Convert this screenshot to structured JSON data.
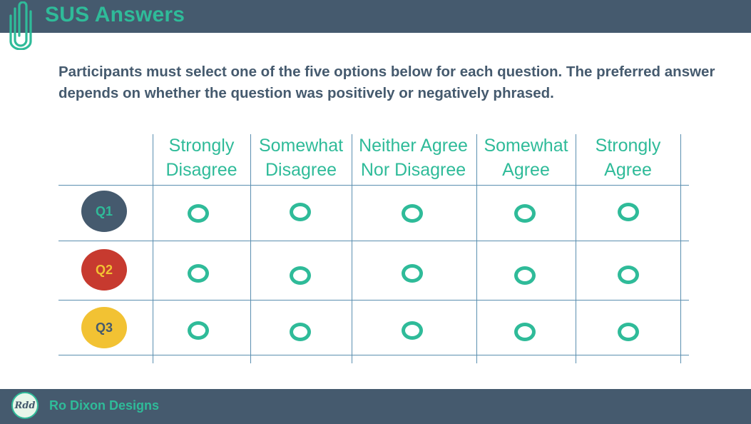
{
  "header": {
    "title": "SUS Answers"
  },
  "intro": "Participants must select one of the five options below for each question. The preferred answer depends on whether the question was positively or negatively phrased.",
  "columns": [
    {
      "line1": "Strongly",
      "line2": "Disagree"
    },
    {
      "line1": "Somewhat",
      "line2": "Disagree"
    },
    {
      "line1": "Neither Agree",
      "line2": "Nor Disagree"
    },
    {
      "line1": "Somewhat",
      "line2": "Agree"
    },
    {
      "line1": "Strongly",
      "line2": "Agree"
    }
  ],
  "questions": [
    {
      "label": "Q1",
      "color": "#455a6e",
      "text_color": "#2fbb99"
    },
    {
      "label": "Q2",
      "color": "#c73a2f",
      "text_color": "#f2c233"
    },
    {
      "label": "Q3",
      "color": "#f2c233",
      "text_color": "#455a6e"
    }
  ],
  "colors": {
    "accent": "#2fbb99",
    "slate": "#455a6e",
    "grid": "#5b8fb0"
  },
  "footer": {
    "logo_text": "Rdd",
    "brand": "Ro Dixon Designs"
  }
}
